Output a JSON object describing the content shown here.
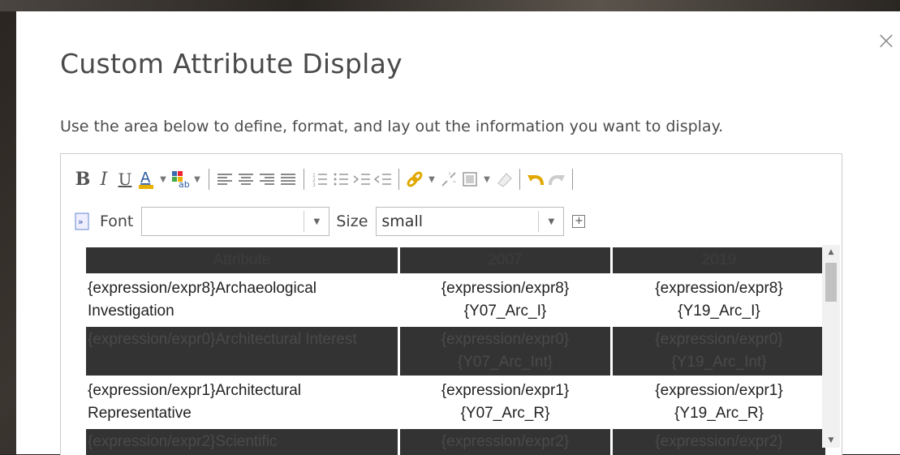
{
  "dialog": {
    "title": "Custom Attribute Display",
    "description": "Use the area below to define, format, and lay out the information you want to display.",
    "close_label": "×"
  },
  "toolbar": {
    "bold": "B",
    "italic": "I",
    "underline": "U",
    "font_label": "Font",
    "font_value": "",
    "size_label": "Size",
    "size_value": "small",
    "icons": [
      "font-color-icon",
      "highlight-color-icon",
      "align-left-icon",
      "align-center-icon",
      "align-right-icon",
      "justify-icon",
      "ordered-list-icon",
      "unordered-list-icon",
      "indent-icon",
      "outdent-icon",
      "link-icon",
      "unlink-icon",
      "insert-image-icon",
      "eraser-icon",
      "undo-icon",
      "redo-icon",
      "source-icon",
      "insert-table-icon"
    ]
  },
  "table": {
    "headers": [
      "Attribute",
      "2007",
      "2019"
    ],
    "rows": [
      {
        "style": "light",
        "c1": "{expression/expr8}Archaeological Investigation",
        "c2": "{expression/expr8}{Y07_Arc_I}",
        "c3": "{expression/expr8}{Y19_Arc_I}"
      },
      {
        "style": "dark",
        "c1": "{expression/expr0}Architectural Interest",
        "c2": "{expression/expr0}{Y07_Arc_Int}",
        "c3": "{expression/expr0}{Y19_Arc_Int}"
      },
      {
        "style": "light",
        "c1": "{expression/expr1}Architectural Representative",
        "c2": "{expression/expr1}{Y07_Arc_R}",
        "c3": "{expression/expr1}{Y19_Arc_R}"
      },
      {
        "style": "dark",
        "c1": "{expression/expr2}Scientific",
        "c2": "{expression/expr2}",
        "c3": "{expression/expr2}"
      }
    ]
  },
  "colors": {
    "header_bg": "#333333",
    "dark_row_bg": "#333333",
    "text": "#222222",
    "accent_yellow": "#f0b400"
  }
}
